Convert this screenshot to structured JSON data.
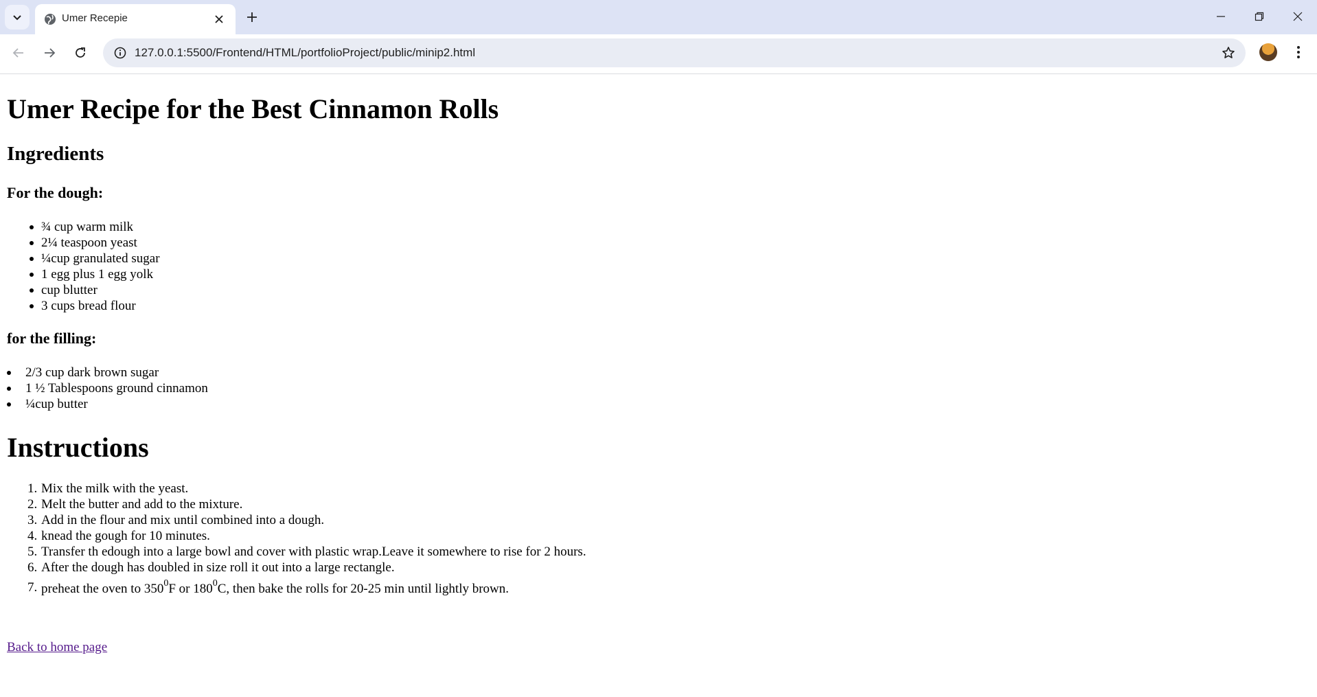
{
  "browser": {
    "tab_title": "Umer Recepie",
    "url": "127.0.0.1:5500/Frontend/HTML/portfolioProject/public/minip2.html"
  },
  "page": {
    "title": "Umer Recipe for the Best Cinnamon Rolls",
    "ingredients_heading": "Ingredients",
    "dough_heading": "For the dough:",
    "dough_items": [
      "¾ cup warm milk",
      "2¼ teaspoon yeast",
      "¼cup granulated sugar",
      "1 egg plus 1 egg yolk",
      "cup blutter",
      "3 cups bread flour"
    ],
    "filling_heading": "for the filling:",
    "filling_items": [
      "2/3 cup dark brown sugar",
      "1 ½ Tablespoons ground cinnamon",
      "¼cup butter"
    ],
    "instructions_heading": "Instructions",
    "instructions": [
      "Mix the milk with the yeast.",
      "Melt the butter and add to the mixture.",
      "Add in the flour and mix until combined into a dough.",
      "knead the gough for 10 minutes.",
      "Transfer th edough into a large bowl and cover with plastic wrap.Leave it somewhere to rise for 2 hours.",
      "After the dough has doubled in size roll it out into a large rectangle."
    ],
    "instruction_7": {
      "part1": "preheat the oven to 350",
      "sup1": "0",
      "part2": "F or 180",
      "sup2": "0",
      "part3": "C, then bake the rolls for 20-25 min until lightly brown."
    },
    "numbers": [
      "1.",
      "2.",
      "3.",
      "4.",
      "5.",
      "6.",
      "7."
    ],
    "back_link": "Back to home page"
  },
  "colors": {
    "tabstrip": "#dde3f5",
    "omnibox": "#e9ecf4",
    "visited_link": "#551a8b"
  },
  "icons": {
    "tab_search": "chevron-down-icon",
    "favicon": "globe-icon",
    "tab_close": "close-icon",
    "new_tab": "plus-icon",
    "back": "arrow-left-icon",
    "forward": "arrow-right-icon",
    "reload": "reload-icon",
    "site_info": "info-icon",
    "bookmark": "star-icon",
    "menu": "kebab-menu-icon"
  }
}
